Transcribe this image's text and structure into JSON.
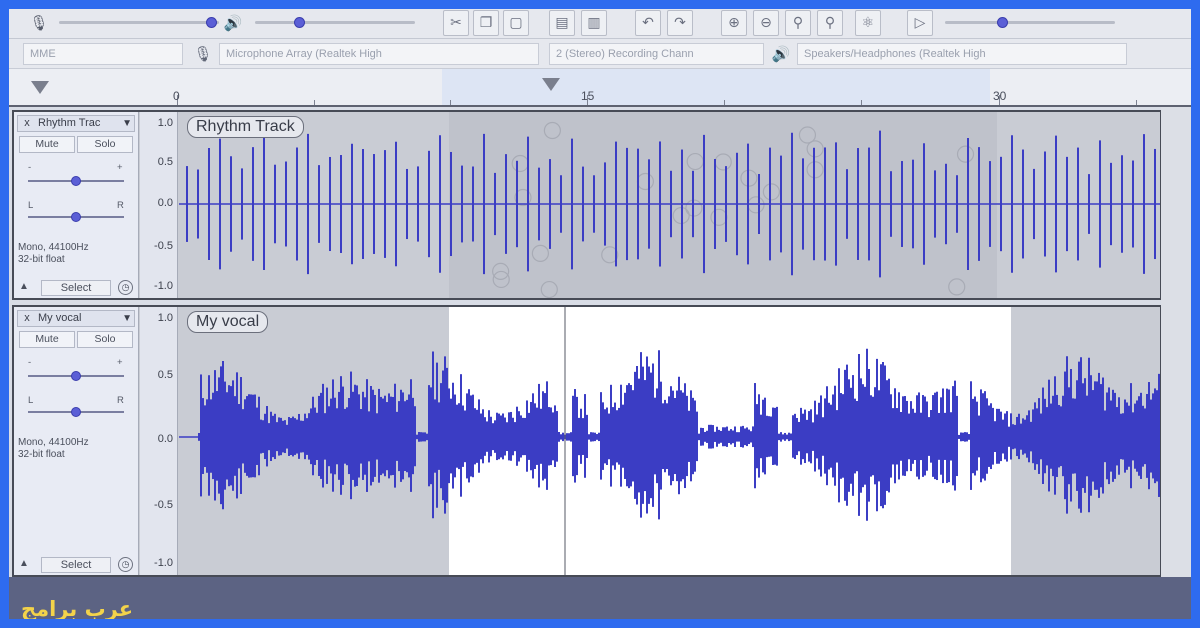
{
  "toolbar": {
    "icons": [
      "microphone-icon",
      "speaker-icon",
      "cut-icon",
      "copy-icon",
      "paste-icon",
      "trim-icon",
      "silence-icon",
      "undo-icon",
      "redo-icon",
      "zoom-in-icon",
      "zoom-out-icon",
      "fit-selection-icon",
      "fit-project-icon",
      "zoom-toggle-icon",
      "play-at-speed-icon"
    ]
  },
  "devices": {
    "host": "MME",
    "recording_device": "Microphone Array (Realtek High",
    "channels": "2 (Stereo) Recording Chann",
    "playback_device": "Speakers/Headphones (Realtek High"
  },
  "ruler": {
    "labels": [
      "0",
      "15",
      "30"
    ]
  },
  "tracks": [
    {
      "name": "Rhythm Track",
      "header_name": "Rhythm Trac",
      "mute": "Mute",
      "solo": "Solo",
      "gain_minus": "-",
      "gain_plus": "+",
      "pan_left": "L",
      "pan_right": "R",
      "info_line1": "Mono, 44100Hz",
      "info_line2": "32-bit float",
      "select": "Select",
      "scale": [
        "1.0",
        "0.5",
        "0.0",
        "-0.5",
        "-1.0"
      ],
      "close": "x"
    },
    {
      "name": "My vocal",
      "header_name": "My vocal",
      "mute": "Mute",
      "solo": "Solo",
      "gain_minus": "-",
      "gain_plus": "+",
      "pan_left": "L",
      "pan_right": "R",
      "info_line1": "Mono, 44100Hz",
      "info_line2": "32-bit float",
      "select": "Select",
      "scale": [
        "1.0",
        "0.5",
        "0.0",
        "-0.5",
        "-1.0"
      ],
      "close": "x"
    }
  ],
  "colors": {
    "waveform": "#3b3dc4",
    "selection": "#ffffff",
    "border": "#2e6bef",
    "watermark": "#f3d34a"
  },
  "watermark": "عرب برامج"
}
